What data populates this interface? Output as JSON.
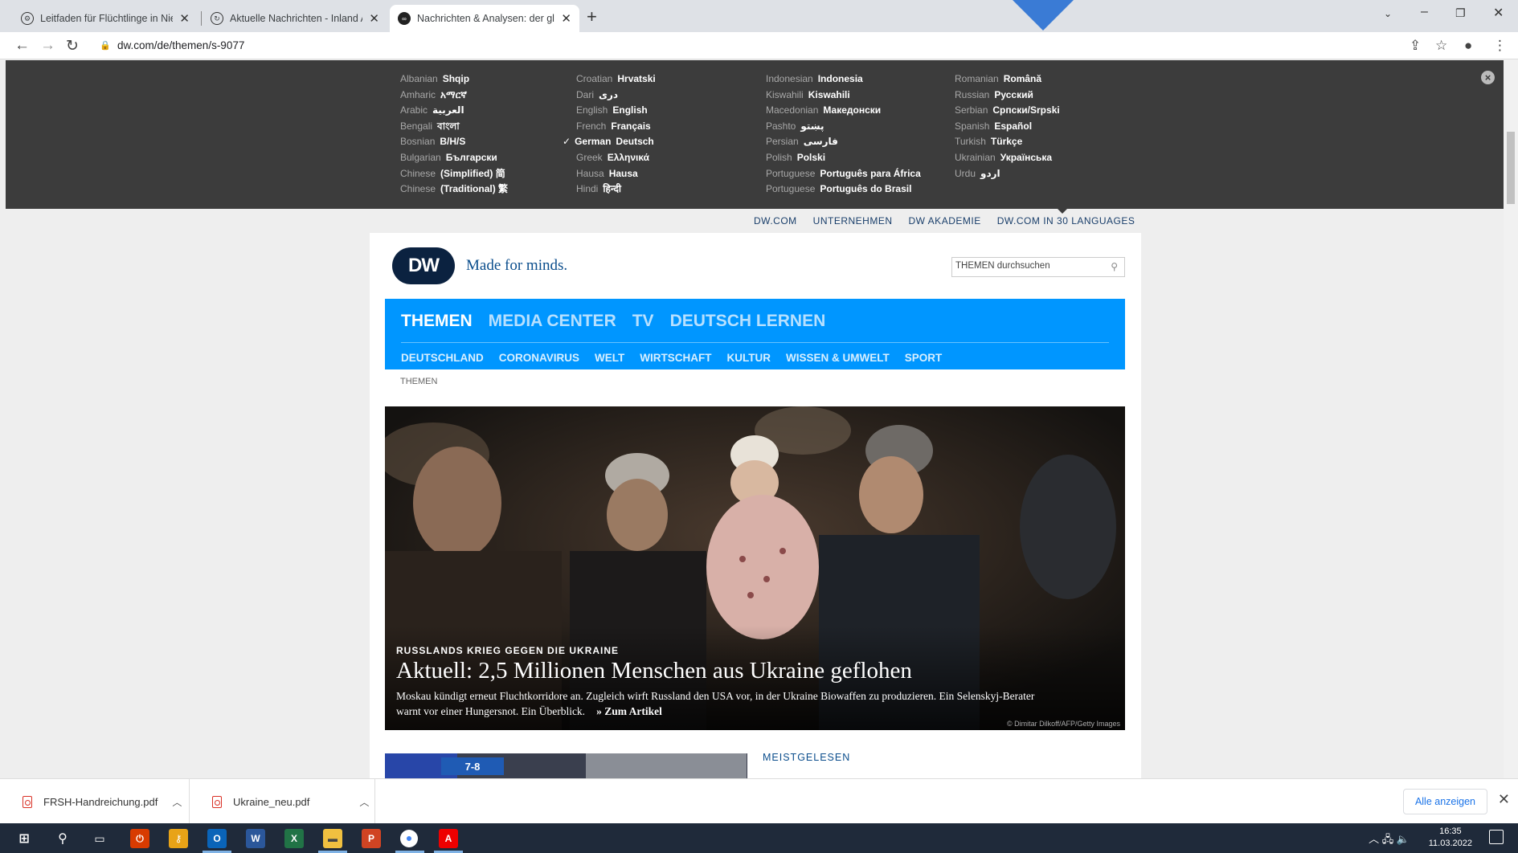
{
  "browser": {
    "tabs": [
      {
        "title": "Leitfaden für Flüchtlinge in Niede",
        "active": false
      },
      {
        "title": "Aktuelle Nachrichten - Inland Au",
        "active": false
      },
      {
        "title": "Nachrichten & Analysen: der glo",
        "active": true
      }
    ],
    "url": "dw.com/de/themen/s-9077"
  },
  "languages": {
    "columns": [
      [
        {
          "en": "Albanian",
          "native": "Shqip"
        },
        {
          "en": "Amharic",
          "native": "አማርኛ"
        },
        {
          "en": "Arabic",
          "native": "العربية"
        },
        {
          "en": "Bengali",
          "native": "বাংলা"
        },
        {
          "en": "Bosnian",
          "native": "B/H/S"
        },
        {
          "en": "Bulgarian",
          "native": "Български"
        },
        {
          "en": "Chinese",
          "native": "(Simplified) 简"
        },
        {
          "en": "Chinese",
          "native": "(Traditional) 繁"
        }
      ],
      [
        {
          "en": "Croatian",
          "native": "Hrvatski"
        },
        {
          "en": "Dari",
          "native": "دری"
        },
        {
          "en": "English",
          "native": "English"
        },
        {
          "en": "French",
          "native": "Français"
        },
        {
          "en": "German",
          "native": "Deutsch",
          "selected": true
        },
        {
          "en": "Greek",
          "native": "Ελληνικά"
        },
        {
          "en": "Hausa",
          "native": "Hausa"
        },
        {
          "en": "Hindi",
          "native": "हिन्दी"
        }
      ],
      [
        {
          "en": "Indonesian",
          "native": "Indonesia"
        },
        {
          "en": "Kiswahili",
          "native": "Kiswahili"
        },
        {
          "en": "Macedonian",
          "native": "Македонски"
        },
        {
          "en": "Pashto",
          "native": "پښتو"
        },
        {
          "en": "Persian",
          "native": "فارسی"
        },
        {
          "en": "Polish",
          "native": "Polski"
        },
        {
          "en": "Portuguese",
          "native": "Português para África"
        },
        {
          "en": "Portuguese",
          "native": "Português do Brasil"
        }
      ],
      [
        {
          "en": "Romanian",
          "native": "Română"
        },
        {
          "en": "Russian",
          "native": "Русский"
        },
        {
          "en": "Serbian",
          "native": "Српски/Srpski"
        },
        {
          "en": "Spanish",
          "native": "Español"
        },
        {
          "en": "Turkish",
          "native": "Türkçe"
        },
        {
          "en": "Ukrainian",
          "native": "Українська"
        },
        {
          "en": "Urdu",
          "native": "اردو"
        }
      ]
    ],
    "selected_mark": "✓"
  },
  "top_links": [
    "DW.COM",
    "UNTERNEHMEN",
    "DW AKADEMIE",
    "DW.COM IN 30 LANGUAGES"
  ],
  "header": {
    "logo": "DW",
    "slogan": "Made for minds.",
    "search_placeholder": "THEMEN durchsuchen"
  },
  "main_nav": [
    "THEMEN",
    "MEDIA CENTER",
    "TV",
    "DEUTSCH LERNEN"
  ],
  "sub_nav": [
    "DEUTSCHLAND",
    "CORONAVIRUS",
    "WELT",
    "WIRTSCHAFT",
    "KULTUR",
    "WISSEN & UMWELT",
    "SPORT"
  ],
  "breadcrumb": "THEMEN",
  "hero": {
    "kicker": "RUSSLANDS KRIEG GEGEN DIE UKRAINE",
    "title": "Aktuell: 2,5 Millionen Menschen aus Ukraine geflohen",
    "teaser": "Moskau kündigt erneut Fluchtkorridore an. Zugleich wirft Russland den USA vor, in der Ukraine Biowaffen zu produzieren. Ein Selenskyj-Berater warnt vor einer Hungersnot. Ein Überblick.",
    "link": "» Zum Artikel",
    "credit": "© Dimitar Dilkoff/AFP/Getty Images"
  },
  "thumb_sign": "7-8",
  "meistgelesen": "MEISTGELESEN",
  "downloads": {
    "items": [
      "FRSH-Handreichung.pdf",
      "Ukraine_neu.pdf"
    ],
    "show_all": "Alle anzeigen"
  },
  "taskbar": {
    "time": "16:35",
    "date": "11.03.2022"
  },
  "colors": {
    "nav_blue": "#0096ff",
    "dw_navy": "#0b2240",
    "panel_bg": "#3c3c3c"
  }
}
